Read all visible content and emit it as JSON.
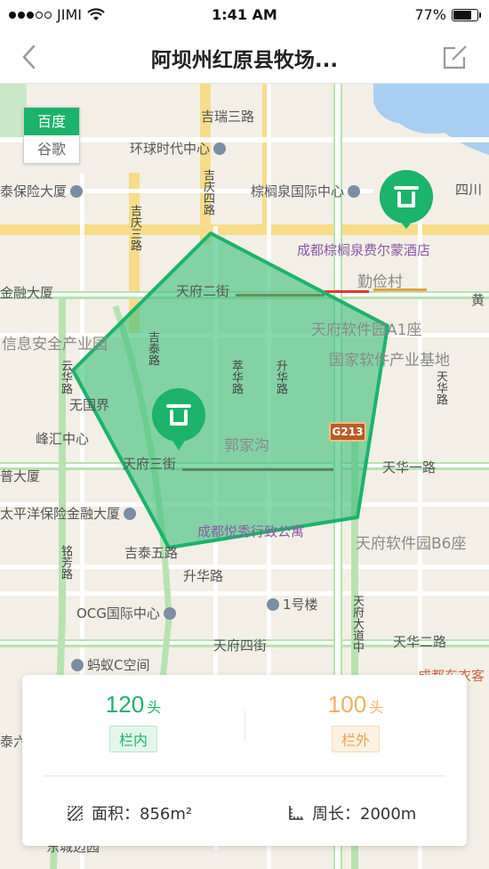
{
  "status": {
    "carrier": "JIMI",
    "time": "1:41 AM",
    "battery": "77%",
    "battery_level": 0.77
  },
  "nav": {
    "title": "阿坝州红原县牧场..."
  },
  "map_switch": {
    "options": [
      "百度",
      "谷歌"
    ],
    "selected": "百度"
  },
  "map_labels": {
    "jirui3": "吉瑞三路",
    "global_center": "环球时代中心",
    "insurance": "泰保险大厦",
    "zongtong": "棕榈泉国际中心",
    "sichuan": "四川",
    "jiqing4": "吉庆四路",
    "jiqing3": "吉庆三路",
    "hotel": "成都棕榈泉费尔蒙酒店",
    "qinjian": "勤俭村",
    "finance": "金融大厦",
    "tianfu2": "天府二街",
    "huang": "黄",
    "infosec": "信息安全产业园",
    "software_a1": "天府软件园A1座",
    "national_software": "国家软件产业基地",
    "jitai": "吉泰路",
    "cuihua": "萃华路",
    "shenghua": "升华路",
    "yunhua": "云华路",
    "tianhua": "天华路",
    "wuguojie": "无国界",
    "guojiagou": "郭家沟",
    "fenghui": "峰汇中心",
    "g213": "G213",
    "tianfu3": "天府三街",
    "tianhua1": "天华一路",
    "puda": "普大厦",
    "pacific": "太平洋保险金融大厦",
    "yuexiu": "成都悦秀行致公寓",
    "software_b6": "天府软件园B6座",
    "jitai5": "吉泰五路",
    "mingfang": "铭芳路",
    "shenghua2": "升华路",
    "ocg": "OCG国际中心",
    "building1": "1号楼",
    "tianfu_ave": "天府大道中",
    "tianfu4": "天府四街",
    "tianhua2": "天华二路",
    "mayi": "蚂蚁C空间",
    "dongyi": "成都东衣客",
    "taiyuan": "泰六",
    "dongcheng": "东城边园"
  },
  "stats": {
    "inside_count": "120",
    "inside_unit": "头",
    "inside_label": "栏内",
    "outside_count": "100",
    "outside_unit": "头",
    "outside_label": "栏外",
    "area_label": "面积：",
    "area_value": "856m²",
    "perimeter_label": "周长：",
    "perimeter_value": "2000m"
  },
  "colors": {
    "accent_green": "#1cb36a",
    "accent_orange": "#f4b05e",
    "fence_fill": "#3cc07a"
  }
}
